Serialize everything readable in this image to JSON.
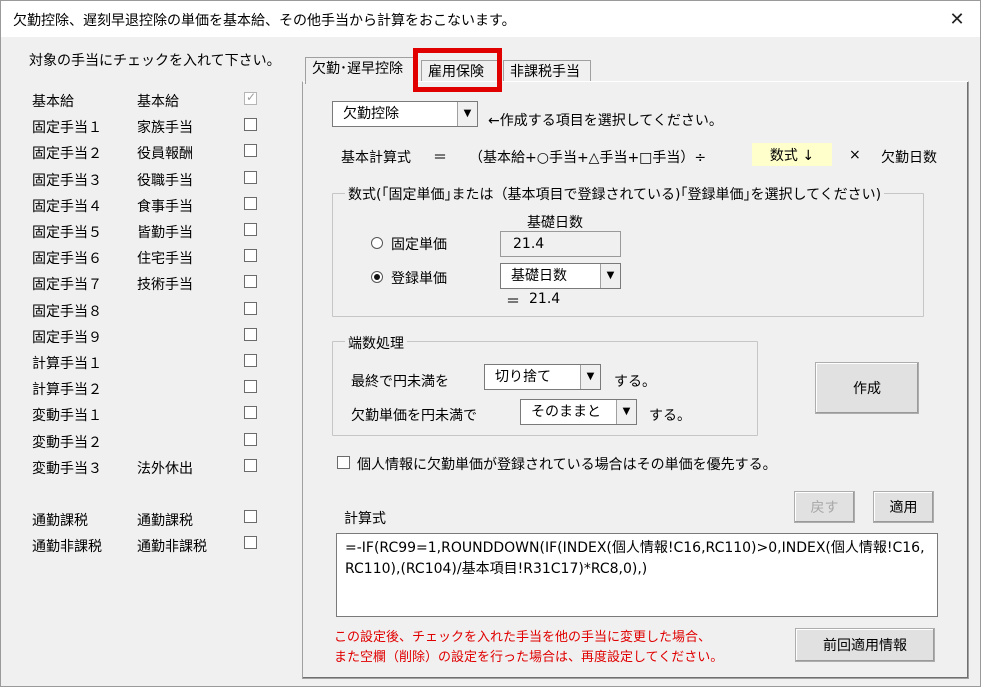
{
  "window": {
    "title": "欠勤控除、遅刻早退控除の単価を基本給、その他手当から計算をおこないます。",
    "close_glyph": "✕"
  },
  "left": {
    "instruction": "対象の手当にチェックを入れて下さい。",
    "rows": [
      {
        "item": "基本給",
        "name": "基本給",
        "checked": true,
        "disabled": true
      },
      {
        "item": "固定手当１",
        "name": "家族手当",
        "checked": false
      },
      {
        "item": "固定手当２",
        "name": "役員報酬",
        "checked": false
      },
      {
        "item": "固定手当３",
        "name": "役職手当",
        "checked": false
      },
      {
        "item": "固定手当４",
        "name": "食事手当",
        "checked": false
      },
      {
        "item": "固定手当５",
        "name": "皆勤手当",
        "checked": false
      },
      {
        "item": "固定手当６",
        "name": "住宅手当",
        "checked": false
      },
      {
        "item": "固定手当７",
        "name": "技術手当",
        "checked": false
      },
      {
        "item": "固定手当８",
        "name": "",
        "checked": false
      },
      {
        "item": "固定手当９",
        "name": "",
        "checked": false
      },
      {
        "item": "計算手当１",
        "name": "",
        "checked": false
      },
      {
        "item": "計算手当２",
        "name": "",
        "checked": false
      },
      {
        "item": "変動手当１",
        "name": "",
        "checked": false
      },
      {
        "item": "変動手当２",
        "name": "",
        "checked": false
      },
      {
        "item": "変動手当３",
        "name": "法外休出",
        "checked": false
      }
    ],
    "commute_rows": [
      {
        "item": "通勤課税",
        "name": "通勤課税",
        "checked": false
      },
      {
        "item": "通勤非課税",
        "name": "通勤非課税",
        "checked": false
      }
    ]
  },
  "tabs": [
    {
      "label": "欠勤･遅早控除",
      "active": true
    },
    {
      "label": "雇用保険",
      "active": false,
      "highlighted": true
    },
    {
      "label": "非課税手当",
      "active": false
    }
  ],
  "panel": {
    "item_select": {
      "value": "欠勤控除",
      "hint": "←作成する項目を選択してください。"
    },
    "formula_line": {
      "label": "基本計算式",
      "eq": "＝",
      "expr": "（基本給+○手当+△手当+□手当）÷",
      "highlight": "数式 ↓",
      "times": "×",
      "days": "欠勤日数"
    },
    "unit_group": {
      "legend": "数式(｢固定単価｣または（基本項目で登録されている)｢登録単価｣を選択してください)",
      "base_days_label": "基礎日数",
      "fixed_label": "固定単価",
      "fixed_value": "21.4",
      "registered_label": "登録単価",
      "registered_select": "基礎日数",
      "result_eq": "＝",
      "result_value": "21.4",
      "selected": "registered"
    },
    "rounding_group": {
      "legend": "端数処理",
      "final_label": "最終で円未満を",
      "final_select": "切り捨て",
      "final_suffix": "する。",
      "unit_label": "欠勤単価を円未満で",
      "unit_select": "そのままと",
      "unit_suffix": "する。"
    },
    "create_button": "作成",
    "priority_checkbox": {
      "label": "個人情報に欠勤単価が登録されている場合はその単価を優先する。",
      "checked": false
    },
    "back_button": "戻す",
    "apply_button": "適用",
    "calc_label": "計算式",
    "formula": "=-IF(RC99=1,ROUNDDOWN(IF(INDEX(個人情報!C16,RC110)>0,INDEX(個人情報!C16,RC110),(RC104)/基本項目!R31C17)*RC8,0),)",
    "warning_line1": "この設定後、チェックを入れた手当を他の手当に変更した場合、",
    "warning_line2": "また空欄（削除）の設定を行った場合は、再度設定してください。",
    "prev_info_button": "前回適用情報"
  },
  "colors": {
    "highlight_box": "#e00000",
    "warning_text": "#e00000",
    "formula_highlight_bg": "#ffffcc"
  }
}
